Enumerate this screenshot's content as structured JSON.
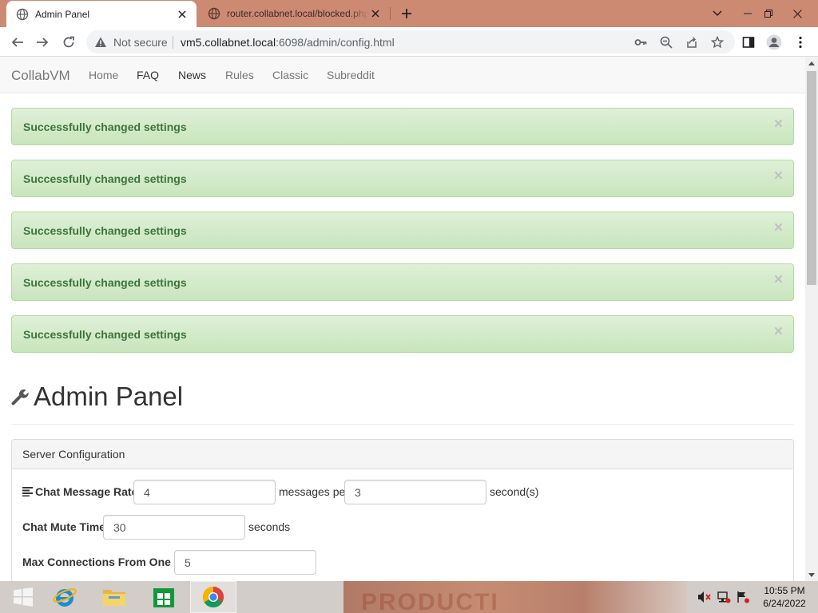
{
  "browser": {
    "tabs": [
      {
        "title": "Admin Panel",
        "active": true
      },
      {
        "title": "router.collabnet.local/blocked.php",
        "active": false
      }
    ],
    "security_label": "Not secure",
    "url_host": "vm5.collabnet.local",
    "url_rest": ":6098/admin/config.html"
  },
  "navbar": {
    "brand": "CollabVM",
    "links": [
      "Home",
      "FAQ",
      "News",
      "Rules",
      "Classic",
      "Subreddit"
    ]
  },
  "alerts": [
    {
      "text": "Successfully changed settings",
      "close": "×"
    },
    {
      "text": "Successfully changed settings",
      "close": "×"
    },
    {
      "text": "Successfully changed settings",
      "close": "×"
    },
    {
      "text": "Successfully changed settings",
      "close": "×"
    },
    {
      "text": "Successfully changed settings",
      "close": "×"
    }
  ],
  "page_title": "Admin Panel",
  "config_panel": {
    "title": "Server Configuration",
    "chat_rate": {
      "label": "Chat Message Rate:",
      "messages_value": "4",
      "middle_text": "messages per",
      "seconds_value": "3",
      "suffix": "second(s)"
    },
    "mute_time": {
      "label": "Chat Mute Time:",
      "value": "30",
      "suffix": "seconds"
    },
    "max_connections": {
      "label": "Max Connections From One IP:",
      "value": "5"
    }
  },
  "taskbar": {
    "time": "10:55 PM",
    "date": "6/24/2022",
    "background_text": "PRODUCTI"
  },
  "colors": {
    "tabstrip": "#cc8a73",
    "alert_bg": "#dff0d8",
    "alert_text": "#3c763d"
  }
}
